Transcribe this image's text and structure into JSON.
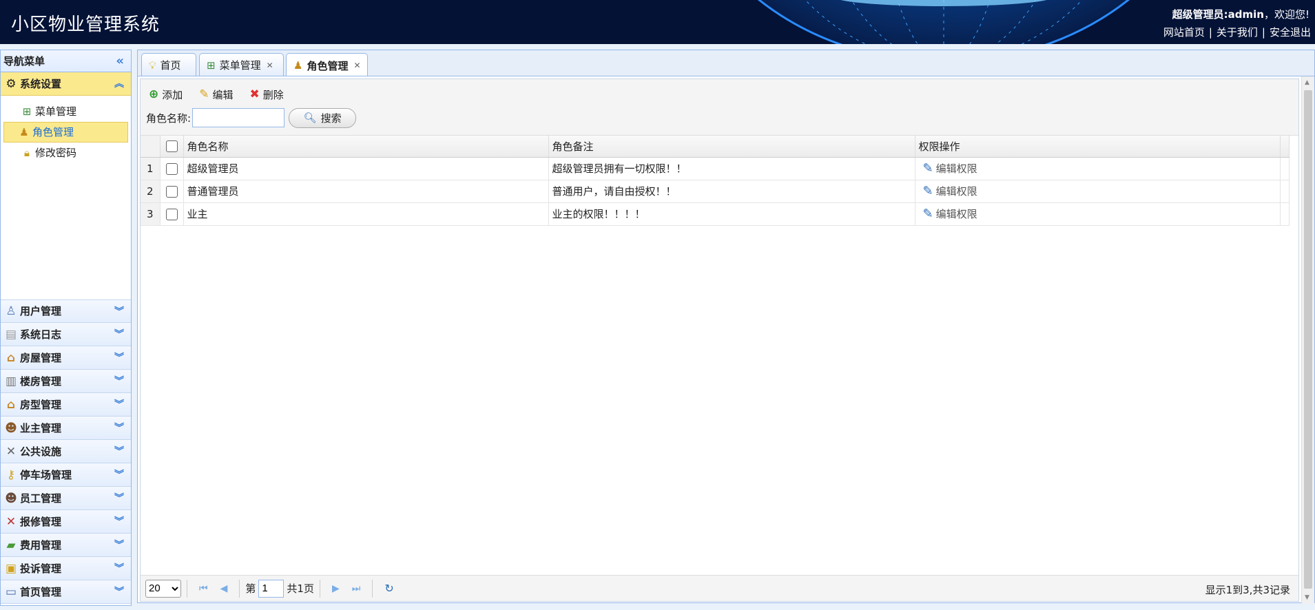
{
  "header": {
    "title": "小区物业管理系统",
    "user_role": "超级管理员:admin",
    "welcome": "，欢迎您!",
    "links": [
      "网站首页",
      "关于我们",
      "安全退出"
    ],
    "separator": "|"
  },
  "sidebar": {
    "title": "导航菜单",
    "active_group": {
      "label": "系统设置",
      "items": [
        {
          "label": "菜单管理",
          "icon": "sitemap-icon"
        },
        {
          "label": "角色管理",
          "icon": "role-icon"
        },
        {
          "label": "修改密码",
          "icon": "lock-icon"
        }
      ]
    },
    "groups": [
      {
        "label": "用户管理",
        "icon": "users-icon"
      },
      {
        "label": "系统日志",
        "icon": "log-icon"
      },
      {
        "label": "房屋管理",
        "icon": "house-icon"
      },
      {
        "label": "楼房管理",
        "icon": "building-icon"
      },
      {
        "label": "房型管理",
        "icon": "house-type-icon"
      },
      {
        "label": "业主管理",
        "icon": "owner-icon"
      },
      {
        "label": "公共设施",
        "icon": "tools-icon"
      },
      {
        "label": "停车场管理",
        "icon": "key-icon"
      },
      {
        "label": "员工管理",
        "icon": "staff-icon"
      },
      {
        "label": "报修管理",
        "icon": "repair-icon"
      },
      {
        "label": "费用管理",
        "icon": "money-icon"
      },
      {
        "label": "投诉管理",
        "icon": "complaint-icon"
      },
      {
        "label": "首页管理",
        "icon": "homepage-icon"
      }
    ]
  },
  "tabs": [
    {
      "label": "首页",
      "closable": false
    },
    {
      "label": "菜单管理",
      "closable": true
    },
    {
      "label": "角色管理",
      "closable": true,
      "active": true
    }
  ],
  "toolbar": {
    "add_label": "添加",
    "edit_label": "编辑",
    "delete_label": "删除",
    "search_label": "角色名称:",
    "search_value": "",
    "search_button": "搜索"
  },
  "table": {
    "columns": [
      "角色名称",
      "角色备注",
      "权限操作"
    ],
    "rows": [
      {
        "num": "1",
        "name": "超级管理员",
        "remark": "超级管理员拥有一切权限！！",
        "action": "编辑权限"
      },
      {
        "num": "2",
        "name": "普通管理员",
        "remark": "普通用户，请自由授权！！",
        "action": "编辑权限"
      },
      {
        "num": "3",
        "name": "业主",
        "remark": "业主的权限！！！！",
        "action": "编辑权限"
      }
    ]
  },
  "pager": {
    "page_size": "20",
    "page_prefix": "第",
    "current_page": "1",
    "total_pages": "共1页",
    "info": "显示1到3,共3记录"
  }
}
